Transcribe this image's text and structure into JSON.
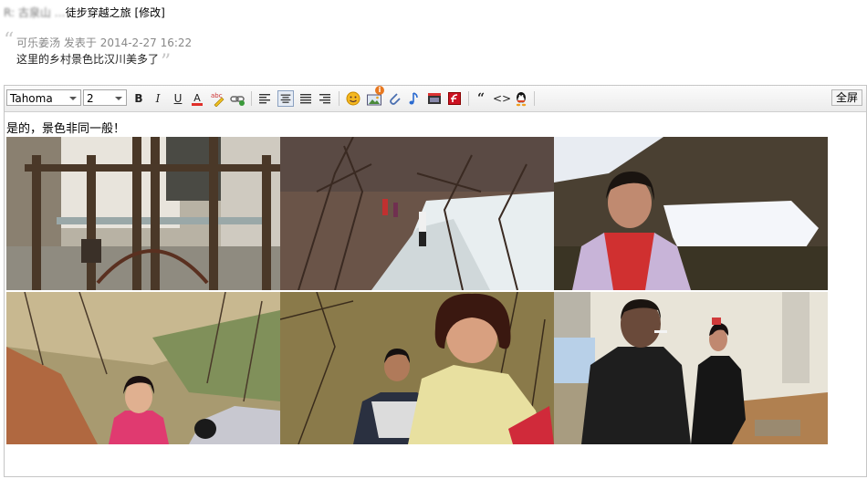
{
  "post": {
    "title_prefix": "R: 古泉山 …",
    "title_main": "徒步穿越之旅",
    "edit_link": "[修改]"
  },
  "quote": {
    "author": "可乐姜汤",
    "posted_label": "发表于",
    "datetime": "2014-2-27 16:22",
    "message": "这里的乡村景色比汉川美多了"
  },
  "toolbar": {
    "font_family": "Tahoma",
    "font_size": "2",
    "bold": "B",
    "italic": "I",
    "underline": "U",
    "font_color": "A",
    "fullscreen_label": "全屏",
    "icons": [
      "bold-icon",
      "italic-icon",
      "underline-icon",
      "font-color-icon",
      "highlight-icon",
      "link-icon",
      "align-left-icon",
      "align-center-icon",
      "align-justify-icon",
      "align-right-icon",
      "emoticon-icon",
      "image-icon",
      "attachment-icon",
      "music-icon",
      "video-icon",
      "flash-icon",
      "quote-icon",
      "code-icon",
      "qq-icon"
    ],
    "badge": "i"
  },
  "editor": {
    "text": "是的，景色非同一般！"
  },
  "photos": [
    {
      "name": "photo-gate"
    },
    {
      "name": "photo-hikers-trail"
    },
    {
      "name": "photo-woman-snow"
    },
    {
      "name": "photo-woman-hillside"
    },
    {
      "name": "photo-woman-smiling"
    },
    {
      "name": "photo-man-smoking"
    }
  ]
}
